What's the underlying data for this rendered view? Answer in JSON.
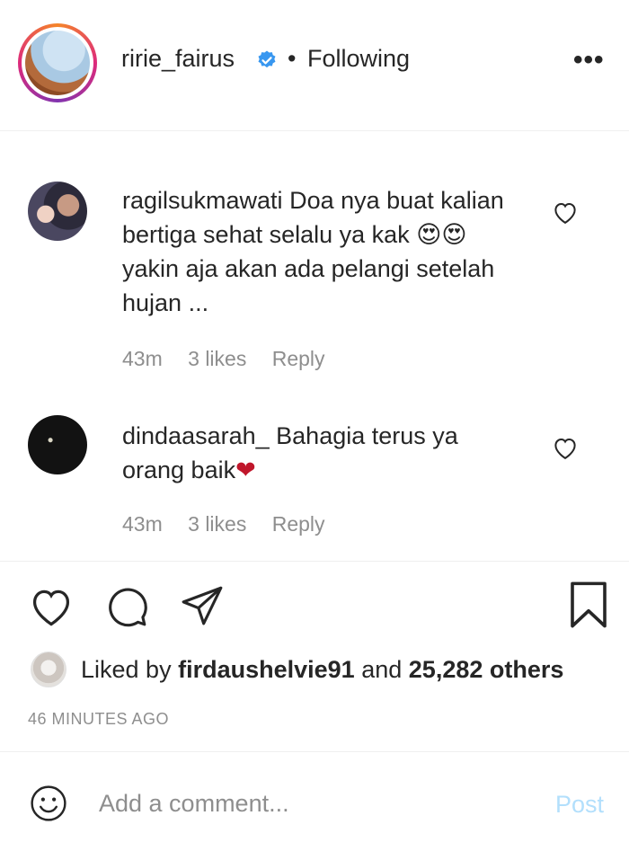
{
  "header": {
    "username": "ririe_fairus",
    "separator": "•",
    "follow_status": "Following",
    "more_label": "•••"
  },
  "comments": [
    {
      "username": "ragilsukmawati",
      "text_line1": "Doa nya buat",
      "text_rest": "kalian bertiga sehat selalu ya kak 😍😍 yakin aja akan ada pelangi setelah hujan ...",
      "time": "43m",
      "likes": "3 likes",
      "reply": "Reply"
    },
    {
      "username": "dindaasarah_",
      "text": "Bahagia terus ya orang baik",
      "emoji": "❤",
      "time": "43m",
      "likes": "3 likes",
      "reply": "Reply"
    }
  ],
  "likes": {
    "prefix": "Liked by",
    "user": "firdaushelvie91",
    "middle": "and",
    "others": "25,282 others"
  },
  "post_time": "46 MINUTES AGO",
  "add_comment": {
    "placeholder": "Add a comment...",
    "post_label": "Post"
  },
  "colors": {
    "verified": "#3897f0",
    "red_heart": "#ed4956",
    "post_disabled": "#b2dffc",
    "muted": "#8e8e8e"
  },
  "icons": [
    "verified-icon",
    "more-icon",
    "heart-icon",
    "comment-icon",
    "share-icon",
    "bookmark-icon",
    "emoji-icon"
  ]
}
